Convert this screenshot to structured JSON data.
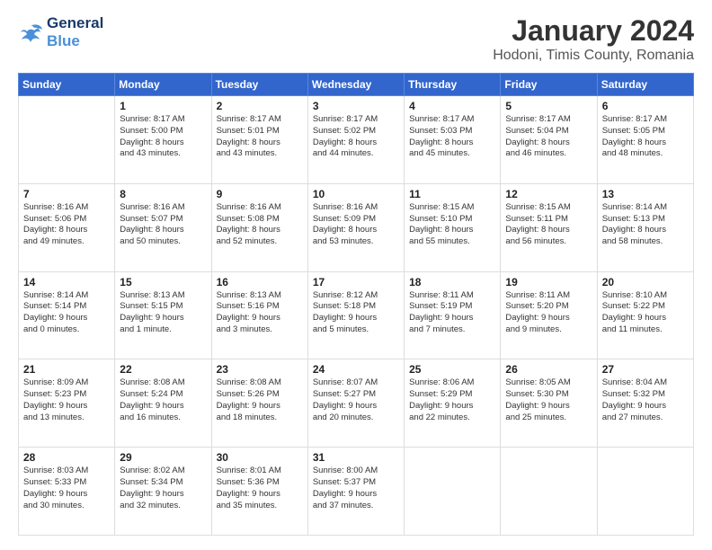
{
  "logo": {
    "line1": "General",
    "line2": "Blue"
  },
  "title": "January 2024",
  "subtitle": "Hodoni, Timis County, Romania",
  "days_header": [
    "Sunday",
    "Monday",
    "Tuesday",
    "Wednesday",
    "Thursday",
    "Friday",
    "Saturday"
  ],
  "weeks": [
    [
      {
        "day": "",
        "info": ""
      },
      {
        "day": "1",
        "info": "Sunrise: 8:17 AM\nSunset: 5:00 PM\nDaylight: 8 hours\nand 43 minutes."
      },
      {
        "day": "2",
        "info": "Sunrise: 8:17 AM\nSunset: 5:01 PM\nDaylight: 8 hours\nand 43 minutes."
      },
      {
        "day": "3",
        "info": "Sunrise: 8:17 AM\nSunset: 5:02 PM\nDaylight: 8 hours\nand 44 minutes."
      },
      {
        "day": "4",
        "info": "Sunrise: 8:17 AM\nSunset: 5:03 PM\nDaylight: 8 hours\nand 45 minutes."
      },
      {
        "day": "5",
        "info": "Sunrise: 8:17 AM\nSunset: 5:04 PM\nDaylight: 8 hours\nand 46 minutes."
      },
      {
        "day": "6",
        "info": "Sunrise: 8:17 AM\nSunset: 5:05 PM\nDaylight: 8 hours\nand 48 minutes."
      }
    ],
    [
      {
        "day": "7",
        "info": "Sunrise: 8:16 AM\nSunset: 5:06 PM\nDaylight: 8 hours\nand 49 minutes."
      },
      {
        "day": "8",
        "info": "Sunrise: 8:16 AM\nSunset: 5:07 PM\nDaylight: 8 hours\nand 50 minutes."
      },
      {
        "day": "9",
        "info": "Sunrise: 8:16 AM\nSunset: 5:08 PM\nDaylight: 8 hours\nand 52 minutes."
      },
      {
        "day": "10",
        "info": "Sunrise: 8:16 AM\nSunset: 5:09 PM\nDaylight: 8 hours\nand 53 minutes."
      },
      {
        "day": "11",
        "info": "Sunrise: 8:15 AM\nSunset: 5:10 PM\nDaylight: 8 hours\nand 55 minutes."
      },
      {
        "day": "12",
        "info": "Sunrise: 8:15 AM\nSunset: 5:11 PM\nDaylight: 8 hours\nand 56 minutes."
      },
      {
        "day": "13",
        "info": "Sunrise: 8:14 AM\nSunset: 5:13 PM\nDaylight: 8 hours\nand 58 minutes."
      }
    ],
    [
      {
        "day": "14",
        "info": "Sunrise: 8:14 AM\nSunset: 5:14 PM\nDaylight: 9 hours\nand 0 minutes."
      },
      {
        "day": "15",
        "info": "Sunrise: 8:13 AM\nSunset: 5:15 PM\nDaylight: 9 hours\nand 1 minute."
      },
      {
        "day": "16",
        "info": "Sunrise: 8:13 AM\nSunset: 5:16 PM\nDaylight: 9 hours\nand 3 minutes."
      },
      {
        "day": "17",
        "info": "Sunrise: 8:12 AM\nSunset: 5:18 PM\nDaylight: 9 hours\nand 5 minutes."
      },
      {
        "day": "18",
        "info": "Sunrise: 8:11 AM\nSunset: 5:19 PM\nDaylight: 9 hours\nand 7 minutes."
      },
      {
        "day": "19",
        "info": "Sunrise: 8:11 AM\nSunset: 5:20 PM\nDaylight: 9 hours\nand 9 minutes."
      },
      {
        "day": "20",
        "info": "Sunrise: 8:10 AM\nSunset: 5:22 PM\nDaylight: 9 hours\nand 11 minutes."
      }
    ],
    [
      {
        "day": "21",
        "info": "Sunrise: 8:09 AM\nSunset: 5:23 PM\nDaylight: 9 hours\nand 13 minutes."
      },
      {
        "day": "22",
        "info": "Sunrise: 8:08 AM\nSunset: 5:24 PM\nDaylight: 9 hours\nand 16 minutes."
      },
      {
        "day": "23",
        "info": "Sunrise: 8:08 AM\nSunset: 5:26 PM\nDaylight: 9 hours\nand 18 minutes."
      },
      {
        "day": "24",
        "info": "Sunrise: 8:07 AM\nSunset: 5:27 PM\nDaylight: 9 hours\nand 20 minutes."
      },
      {
        "day": "25",
        "info": "Sunrise: 8:06 AM\nSunset: 5:29 PM\nDaylight: 9 hours\nand 22 minutes."
      },
      {
        "day": "26",
        "info": "Sunrise: 8:05 AM\nSunset: 5:30 PM\nDaylight: 9 hours\nand 25 minutes."
      },
      {
        "day": "27",
        "info": "Sunrise: 8:04 AM\nSunset: 5:32 PM\nDaylight: 9 hours\nand 27 minutes."
      }
    ],
    [
      {
        "day": "28",
        "info": "Sunrise: 8:03 AM\nSunset: 5:33 PM\nDaylight: 9 hours\nand 30 minutes."
      },
      {
        "day": "29",
        "info": "Sunrise: 8:02 AM\nSunset: 5:34 PM\nDaylight: 9 hours\nand 32 minutes."
      },
      {
        "day": "30",
        "info": "Sunrise: 8:01 AM\nSunset: 5:36 PM\nDaylight: 9 hours\nand 35 minutes."
      },
      {
        "day": "31",
        "info": "Sunrise: 8:00 AM\nSunset: 5:37 PM\nDaylight: 9 hours\nand 37 minutes."
      },
      {
        "day": "",
        "info": ""
      },
      {
        "day": "",
        "info": ""
      },
      {
        "day": "",
        "info": ""
      }
    ]
  ]
}
